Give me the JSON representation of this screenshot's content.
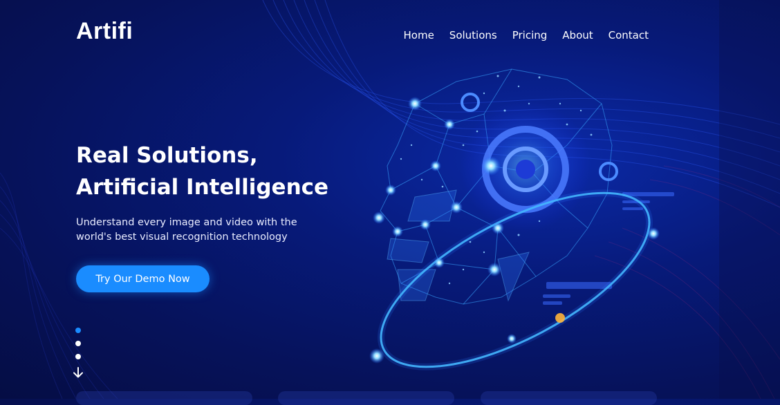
{
  "brand": {
    "logo": "Artifi"
  },
  "nav": {
    "items": [
      "Home",
      "Solutions",
      "Pricing",
      "About",
      "Contact"
    ]
  },
  "hero": {
    "headline_line1": "Real Solutions,",
    "headline_line2": "Artificial Intelligence",
    "subtext_line1": "Understand every image and video with the",
    "subtext_line2": "world's best visual recognition technology",
    "cta_label": "Try Our Demo Now"
  },
  "slider": {
    "total": 3,
    "active_index": 0
  },
  "icons": {
    "scroll_down": "arrow-down-icon"
  },
  "colors": {
    "accent": "#1a8cff",
    "background_dark": "#06125a",
    "glow": "#3fb7ff"
  }
}
